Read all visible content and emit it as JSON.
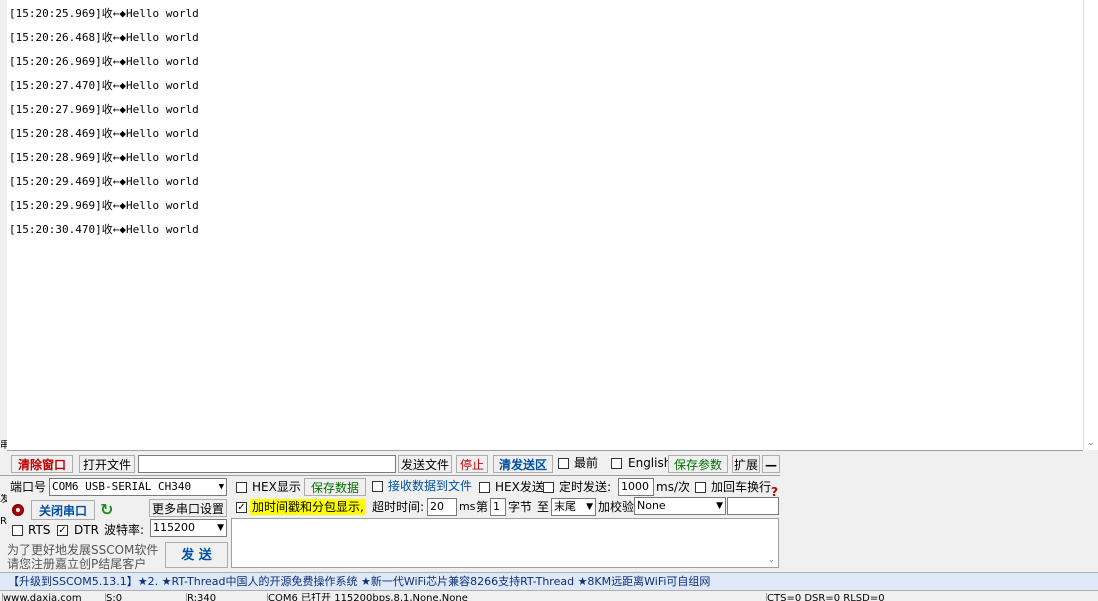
{
  "receive": {
    "lines": [
      "[15:20:25.969]收←◆Hello world",
      "[15:20:26.468]收←◆Hello world",
      "[15:20:26.969]收←◆Hello world",
      "[15:20:27.470]收←◆Hello world",
      "[15:20:27.969]收←◆Hello world",
      "[15:20:28.469]收←◆Hello world",
      "[15:20:28.969]收←◆Hello world",
      "[15:20:29.469]收←◆Hello world",
      "[15:20:29.969]收←◆Hello world",
      "[15:20:30.470]收←◆Hello world"
    ]
  },
  "left_strip": {
    "c1": "串",
    "c2": "发",
    "c3": "R"
  },
  "toolbar1": {
    "clear_window": "清除窗口",
    "open_file": "打开文件",
    "file_path": "",
    "send_file": "发送文件",
    "stop": "停止",
    "clear_send": "清发送区",
    "topmost": "最前",
    "english": "English",
    "save_params": "保存参数",
    "expand": "扩展",
    "collapse": "—"
  },
  "port": {
    "label": "端口号",
    "value": "COM6 USB-SERIAL CH340",
    "close_port": "关闭串口",
    "more_settings": "更多串口设置",
    "rts": "RTS",
    "dtr": "DTR",
    "baud_label": "波特率:",
    "baud_value": "115200",
    "promo1": "为了更好地发展SSCOM软件",
    "promo2": "请您注册嘉立创P结尾客户"
  },
  "options": {
    "hex_display": "HEX显示",
    "save_data": "保存数据",
    "recv_to_file": "接收数据到文件",
    "hex_send": "HEX发送",
    "timed_send": "定时发送:",
    "interval": "1000",
    "interval_unit": "ms/次",
    "add_crlf": "加回车换行",
    "add_timestamp": "加时间戳和分包显示,",
    "timeout_label": "超时时间:",
    "timeout_value": "20",
    "timeout_unit": "ms",
    "nth_label": "第",
    "nth_value": "1",
    "byte_label": "字节",
    "to_label": "至",
    "end_value": "末尾",
    "checksum_label": "加校验",
    "checksum_value": "None",
    "send_button": "发 送"
  },
  "marquee": "【升级到SSCOM5.13.1】★2. ★RT-Thread中国人的开源免费操作系统 ★新一代WiFi芯片兼容8266支持RT-Thread ★8KM远距离WiFi可自组网",
  "statusbar": {
    "c1": "www.daxia.com",
    "c2": "S:0",
    "c3": "R:340",
    "c4": "COM6 已打开  115200bps,8,1,None,None",
    "c5": "CTS=0 DSR=0 RLSD=0"
  },
  "colors": {
    "red": "#c00000",
    "blue": "#0050a0",
    "green": "#007000",
    "highlight": "#ffff00"
  }
}
